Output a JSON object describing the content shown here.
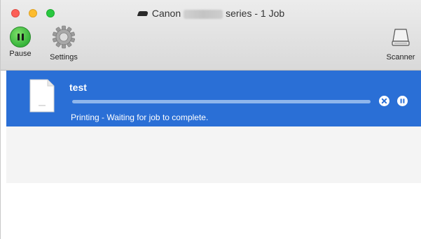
{
  "window": {
    "title_left": "Canon",
    "title_right": "series - 1 Job"
  },
  "toolbar": {
    "pause_label": "Pause",
    "settings_label": "Settings",
    "scanner_label": "Scanner"
  },
  "job": {
    "name": "test",
    "status": "Printing - Waiting for job to complete.",
    "progress": 1.0
  },
  "colors": {
    "selection": "#2a6fd6",
    "progress": "#8fb6ec"
  },
  "icons": [
    "printer-icon",
    "pause-icon",
    "gear-icon",
    "scanner-icon",
    "document-icon",
    "delete-job-icon",
    "hold-job-icon"
  ]
}
